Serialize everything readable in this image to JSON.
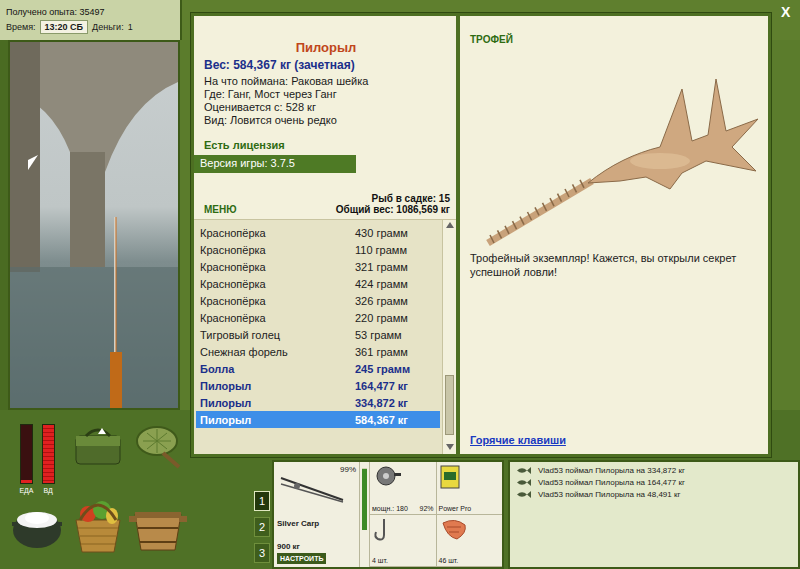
{
  "status": {
    "experience": "Получено опыта: 35497",
    "time_label": "Время:",
    "time": "13:20 СБ",
    "money_label": "Деньги:",
    "money": "1"
  },
  "close": "X",
  "fish_info": {
    "name": "Пилорыл",
    "weight": "Вес: 584,367 кг (зачетная)",
    "details": [
      "На что поймана: Раковая шейка",
      "Где: Ганг, Мост через Ганг",
      "Оценивается с: 528 кг",
      "Вид: Ловится очень редко"
    ],
    "license": "Есть лицензия",
    "version": "Версия игры: 3.7.5"
  },
  "menu": {
    "label": "МЕНЮ",
    "count": "Рыб в садке: 15",
    "total": "Общий вес: 1086,569 кг"
  },
  "catch_list": [
    {
      "name": "Краснопёрка",
      "weight": "430 грамм",
      "highlight": false,
      "selected": false
    },
    {
      "name": "Краснопёрка",
      "weight": "110 грамм",
      "highlight": false,
      "selected": false
    },
    {
      "name": "Краснопёрка",
      "weight": "321 грамм",
      "highlight": false,
      "selected": false
    },
    {
      "name": "Краснопёрка",
      "weight": "424 грамм",
      "highlight": false,
      "selected": false
    },
    {
      "name": "Краснопёрка",
      "weight": "326 грамм",
      "highlight": false,
      "selected": false
    },
    {
      "name": "Краснопёрка",
      "weight": "220 грамм",
      "highlight": false,
      "selected": false
    },
    {
      "name": "Тигровый голец",
      "weight": "53 грамм",
      "highlight": false,
      "selected": false
    },
    {
      "name": "Снежная форель",
      "weight": "361 грамм",
      "highlight": false,
      "selected": false
    },
    {
      "name": "Болла",
      "weight": "245 грамм",
      "highlight": true,
      "selected": false
    },
    {
      "name": "Пилорыл",
      "weight": "164,477 кг",
      "highlight": true,
      "selected": false
    },
    {
      "name": "Пилорыл",
      "weight": "334,872 кг",
      "highlight": true,
      "selected": false
    },
    {
      "name": "Пилорыл",
      "weight": "584,367 кг",
      "highlight": true,
      "selected": true
    }
  ],
  "scrollbar": {
    "level": 0.95
  },
  "trophy": {
    "title": "ТРОФЕЙ",
    "text": "Трофейный экземпляр! Кажется, вы открыли секрет успешной ловли!",
    "hotkeys": "Горячие клавиши"
  },
  "meters": [
    {
      "label": "ЕДА",
      "level": 0.05
    },
    {
      "label": "ВД",
      "level": 1.0
    }
  ],
  "slots": [
    {
      "label": "1",
      "selected": true
    },
    {
      "label": "2",
      "selected": false
    },
    {
      "label": "3",
      "selected": false
    }
  ],
  "tackle": {
    "rod": {
      "name": "Silver Carp",
      "capacity": "900 кг",
      "wear": "99%",
      "wear_level": 0.99,
      "button": "НАСТРОИТЬ"
    },
    "reel": {
      "power": "мощн.: 180",
      "wear": "92%",
      "wear_level": 0.92
    },
    "line": {
      "name": "Power Pro"
    },
    "hook": {
      "count": "4 шт."
    },
    "bait": {
      "count": "46 шт."
    }
  },
  "log": [
    "Vlad53 поймал Пилорыла на 334,872 кг",
    "Vlad53 поймал Пилорыла на 164,477 кг",
    "Vlad53 поймал Пилорыла на 48,491 кг"
  ]
}
